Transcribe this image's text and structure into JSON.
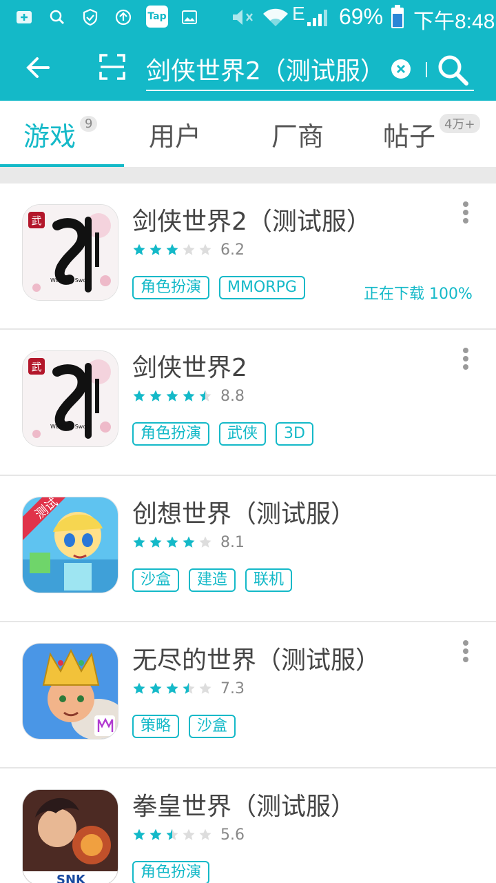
{
  "status_bar": {
    "battery": "69%",
    "time": "下午8:48",
    "network": "E",
    "app_badge": "Tap"
  },
  "header": {
    "search_value": "剑侠世界2（测试服）"
  },
  "tabs": [
    {
      "label": "游戏",
      "badge": "9"
    },
    {
      "label": "用户",
      "badge": ""
    },
    {
      "label": "厂商",
      "badge": ""
    },
    {
      "label": "帖子",
      "badge": "4万+"
    }
  ],
  "games": [
    {
      "title": "剑侠世界2（测试服）",
      "rating": 3,
      "score": "6.2",
      "tags": [
        "角色扮演",
        "MMORPG"
      ],
      "status": "正在下载 100%"
    },
    {
      "title": "剑侠世界2",
      "rating": 4.5,
      "score": "8.8",
      "tags": [
        "角色扮演",
        "武侠",
        "3D"
      ],
      "status": ""
    },
    {
      "title": "创想世界（测试服）",
      "rating": 4,
      "score": "8.1",
      "tags": [
        "沙盒",
        "建造",
        "联机"
      ],
      "status": ""
    },
    {
      "title": "无尽的世界（测试服）",
      "rating": 3.5,
      "score": "7.3",
      "tags": [
        "策略",
        "沙盒"
      ],
      "status": ""
    },
    {
      "title": "拳皇世界（测试服）",
      "rating": 2.5,
      "score": "5.6",
      "tags": [
        "角色扮演"
      ],
      "status": ""
    }
  ],
  "icons": {
    "tag1": "World of Sword",
    "tag3": "测试",
    "snk": "SNK"
  },
  "colors": {
    "accent": "#14b9c8",
    "star_on": "#14b9c8",
    "star_off": "#dddddd"
  }
}
